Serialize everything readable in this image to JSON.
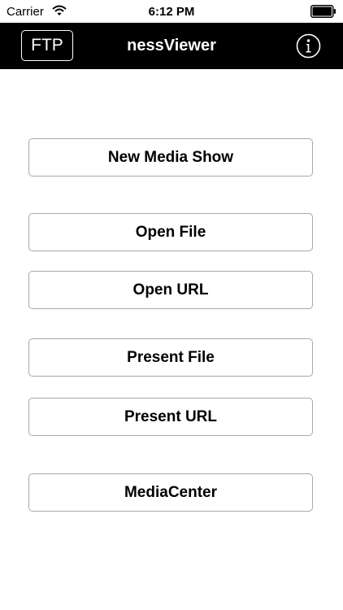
{
  "status_bar": {
    "carrier": "Carrier",
    "time": "6:12 PM"
  },
  "nav": {
    "ftp_label": "FTP",
    "title": "nessViewer",
    "info_icon": "info-icon"
  },
  "buttons": {
    "new_media_show": "New Media Show",
    "open_file": "Open File",
    "open_url": "Open URL",
    "present_file": "Present File",
    "present_url": "Present URL",
    "media_center": "MediaCenter"
  },
  "colors": {
    "nav_background": "#000000",
    "button_border": "#a8a8a8",
    "background": "#ffffff"
  }
}
